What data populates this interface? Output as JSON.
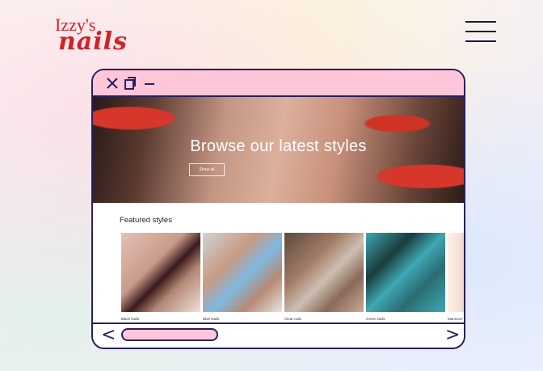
{
  "logo": {
    "line1": "Izzy's",
    "line2": "nails",
    "color": "#d22027"
  },
  "header": {
    "menu_icon": "hamburger-menu-icon"
  },
  "window": {
    "titlebar": {
      "icons": [
        "close-icon",
        "copy-icon",
        "minimize-icon"
      ],
      "color": "#ffc6da"
    },
    "hero": {
      "title": "Browse our latest styles",
      "button_label": "Show all"
    },
    "featured": {
      "heading": "Featured styles",
      "items": [
        {
          "label": "Black Nails",
          "colors": [
            "#3b1a1c",
            "#d8b3a6"
          ]
        },
        {
          "label": "Blue Nails",
          "colors": [
            "#7fb8e0",
            "#c99a84"
          ]
        },
        {
          "label": "Clear nails",
          "colors": [
            "#cdbfb4",
            "#a27a66"
          ]
        },
        {
          "label": "Green Nails",
          "colors": [
            "#3fa7b3",
            "#1a3c3d"
          ]
        },
        {
          "label": "Manicure",
          "colors": [
            "#f0d7c9",
            "#fff2ea"
          ]
        }
      ]
    },
    "bottombar": {
      "prev": "<",
      "next": ">"
    }
  }
}
